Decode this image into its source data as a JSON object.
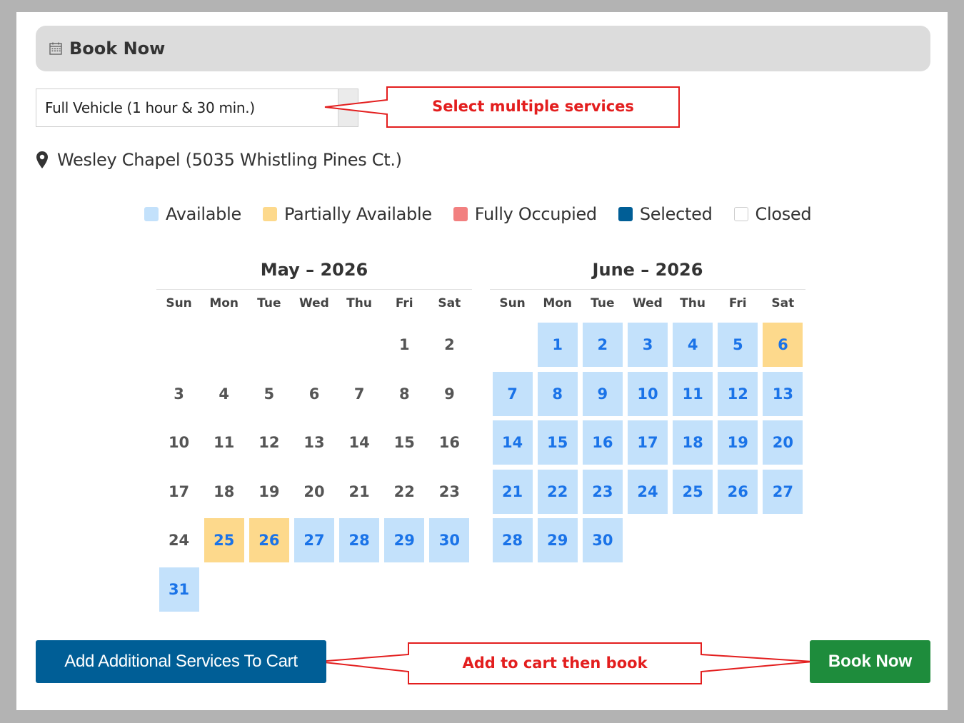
{
  "header": {
    "title": "Book Now",
    "icon": "calendar-icon"
  },
  "service_select": {
    "value": "Full Vehicle (1 hour & 30 min.)"
  },
  "location": {
    "icon": "map-pin-icon",
    "text": "Wesley Chapel (5035 Whistling Pines Ct.)"
  },
  "legend": [
    {
      "label": "Available",
      "color": "#c3e1fb"
    },
    {
      "label": "Partially Available",
      "color": "#fdd98c"
    },
    {
      "label": "Fully Occupied",
      "color": "#f28080"
    },
    {
      "label": "Selected",
      "color": "#005e96"
    },
    {
      "label": "Closed",
      "color": "#ffffff"
    }
  ],
  "weekdays": [
    "Sun",
    "Mon",
    "Tue",
    "Wed",
    "Thu",
    "Fri",
    "Sat"
  ],
  "calendars": [
    {
      "title": "May – 2026",
      "first_weekday": 5,
      "days_in_month": 31,
      "available": [
        27,
        28,
        29,
        30,
        31
      ],
      "partial": [
        25,
        26
      ]
    },
    {
      "title": "June – 2026",
      "first_weekday": 1,
      "days_in_month": 30,
      "available": [
        1,
        2,
        3,
        4,
        5,
        7,
        8,
        9,
        10,
        11,
        12,
        13,
        14,
        15,
        16,
        17,
        18,
        19,
        20,
        21,
        22,
        23,
        24,
        25,
        26,
        27,
        28,
        29,
        30
      ],
      "partial": [
        6
      ]
    }
  ],
  "buttons": {
    "add_to_cart": "Add Additional Services To Cart",
    "book_now": "Book Now"
  },
  "annotations": {
    "select_callout": "Select multiple services",
    "cart_callout": "Add to cart then book",
    "color": "#e31e1e"
  }
}
